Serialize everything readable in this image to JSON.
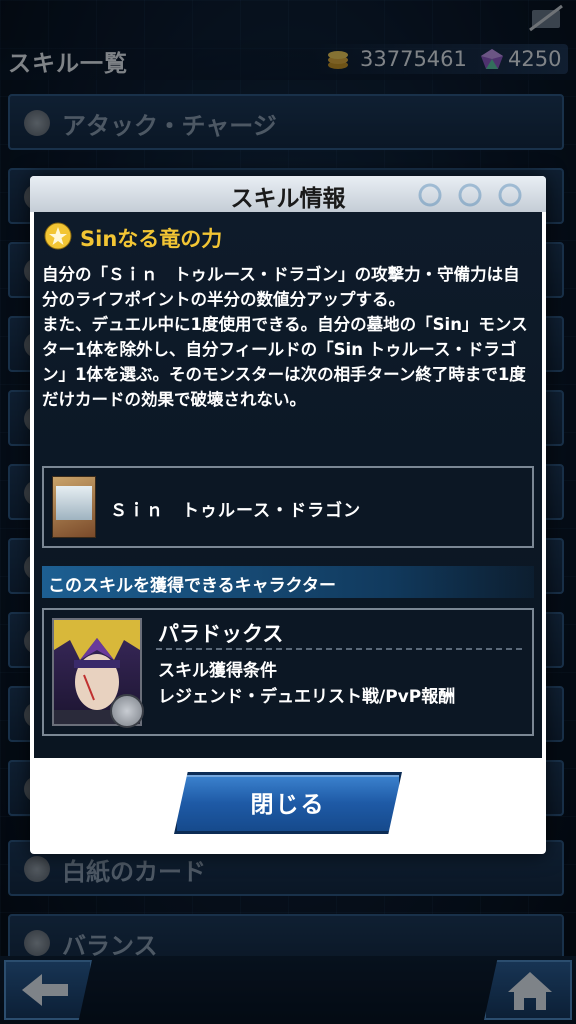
{
  "header": {
    "title": "スキル一覧",
    "coins": "33775461",
    "gems": "4250"
  },
  "background_skills": [
    {
      "label": "アタック・チャージ"
    },
    {
      "label": ""
    },
    {
      "label": ""
    },
    {
      "label": ""
    },
    {
      "label": ""
    },
    {
      "label": ""
    },
    {
      "label": ""
    },
    {
      "label": ""
    },
    {
      "label": ""
    },
    {
      "label": ""
    },
    {
      "label": "白紙のカード"
    },
    {
      "label": "バランス"
    }
  ],
  "modal": {
    "title": "スキル情報",
    "skill_name": "Sinなる竜の力",
    "description": "自分の「Ｓｉｎ　トゥルース・ドラゴン」の攻撃力・守備力は自分のライフポイントの半分の数値分アップする。\nまた、デュエル中に1度使用できる。自分の墓地の「Sin」モンスター1体を除外し、自分フィールドの「Sin トゥルース・ドラゴン」1体を選ぶ。そのモンスターは次の相手ターン終了時まで1度だけカードの効果で破壊されない。",
    "card_name": "Ｓｉｎ　トゥルース・ドラゴン",
    "section_header": "このスキルを獲得できるキャラクター",
    "character_name": "パラドックス",
    "condition_label": "スキル獲得条件",
    "condition_value": "レジェンド・デュエリスト戦/PvP報酬",
    "close_label": "閉じる"
  },
  "icons": {
    "skill_icon": "star-badge-icon",
    "coin_icon": "coin-stack-icon",
    "gem_icon": "gem-icon",
    "back_icon": "arrow-left-icon",
    "home_icon": "home-icon",
    "top_right_icon": "slashed-card-icon"
  },
  "colors": {
    "skill_name": "#f2c534",
    "section_header": "#1d5f92",
    "close_button": "#1e5aa6"
  }
}
